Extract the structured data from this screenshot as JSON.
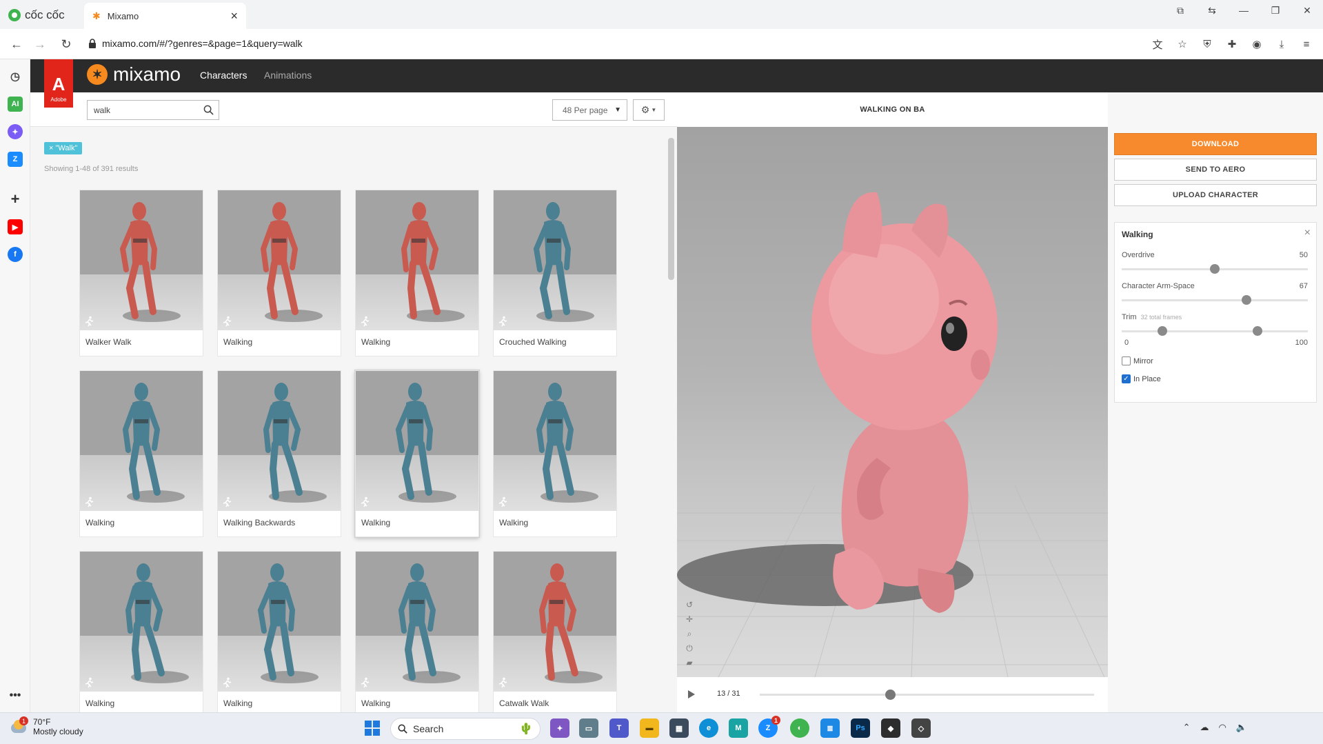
{
  "browser": {
    "brand": "cốc cốc",
    "tab_title": "Mixamo",
    "url": "mixamo.com/#/?genres=&page=1&query=walk"
  },
  "mixamo": {
    "adobe_label": "Adobe",
    "logo_text": "mixamo",
    "nav": [
      "Characters",
      "Animations"
    ]
  },
  "toolbar": {
    "search_value": "walk",
    "per_page": "48 Per page"
  },
  "filter_tag": "\"Walk\"",
  "results_text": "Showing 1-48 of 391 results",
  "cards": [
    {
      "label": "Walker Walk",
      "model": "red"
    },
    {
      "label": "Walking",
      "model": "red"
    },
    {
      "label": "Walking",
      "model": "red"
    },
    {
      "label": "Crouched Walking",
      "model": "blue"
    },
    {
      "label": "Walking",
      "model": "blue"
    },
    {
      "label": "Walking Backwards",
      "model": "blue"
    },
    {
      "label": "Walking",
      "model": "blue"
    },
    {
      "label": "Walking",
      "model": "blue"
    },
    {
      "label": "Walking",
      "model": "blue"
    },
    {
      "label": "Walking",
      "model": "blue"
    },
    {
      "label": "Walking",
      "model": "blue"
    },
    {
      "label": "Catwalk Walk",
      "model": "red"
    }
  ],
  "viewer": {
    "title": "WALKING ON BA",
    "frame_text": "13 / 31",
    "frame_progress": 0.39
  },
  "panel": {
    "download": "DOWNLOAD",
    "send_to_aero": "SEND TO AERO",
    "upload_character": "UPLOAD CHARACTER",
    "anim_name": "Walking",
    "overdrive_label": "Overdrive",
    "overdrive_value": "50",
    "overdrive_fraction": 0.5,
    "armspace_label": "Character Arm-Space",
    "armspace_value": "67",
    "armspace_fraction": 0.67,
    "trim_label": "Trim",
    "trim_sub": "32 total frames",
    "trim_min": "0",
    "trim_max": "100",
    "trim_start_fraction": 0.22,
    "trim_end_fraction": 0.73,
    "mirror_label": "Mirror",
    "mirror_checked": false,
    "inplace_label": "In Place",
    "inplace_checked": true
  },
  "taskbar": {
    "weather_temp": "70°F",
    "weather_cond": "Mostly cloudy",
    "search_placeholder": "Search",
    "weather_badge": "1",
    "mail_badge": "1"
  },
  "colors": {
    "accent_orange": "#f68a2c",
    "tag_teal": "#4fc1d9",
    "adobe_red": "#e1251b",
    "header_dark": "#2b2b2b",
    "model_red": "#c95a50",
    "model_blue": "#4b7f92",
    "pig_pink": "#e8898e"
  }
}
